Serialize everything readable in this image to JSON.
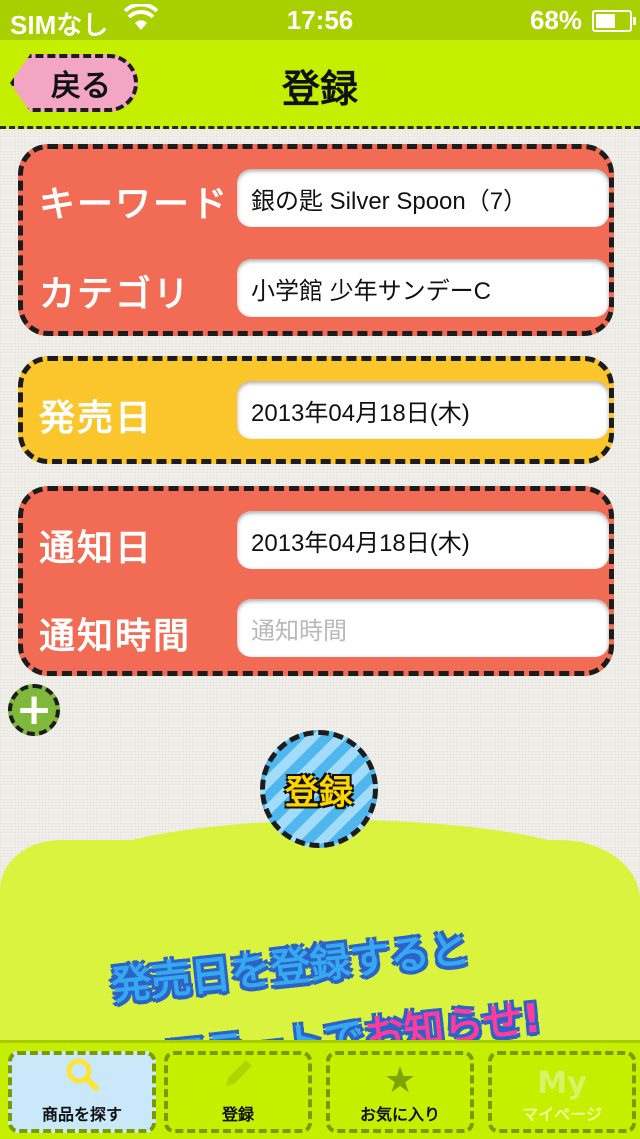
{
  "status_bar": {
    "carrier": "SIMなし",
    "time": "17:56",
    "battery_percent": "68%",
    "battery_level": 0.68
  },
  "nav": {
    "back_label": "戻る",
    "title": "登録"
  },
  "form": {
    "keyword_label": "キーワード",
    "keyword_value": "銀の匙 Silver Spoon（7）",
    "category_label": "カテゴリ",
    "category_value": "小学館 少年サンデーC",
    "release_label": "発売日",
    "release_value": "2013年04月18日(木)",
    "notify_date_label": "通知日",
    "notify_date_value": "2013年04月18日(木)",
    "notify_time_label": "通知時間",
    "notify_time_placeholder": "通知時間"
  },
  "add_button": "+",
  "submit_label": "登録",
  "promo": {
    "line1": "発売日を登録すると",
    "line2_a": "アラートで",
    "line2_b": "お知らせ!"
  },
  "tabs": [
    {
      "label": "商品を探す",
      "icon": "search-icon"
    },
    {
      "label": "登録",
      "icon": "pencil-icon"
    },
    {
      "label": "お気に入り",
      "icon": "star-icon"
    },
    {
      "label": "マイページ",
      "icon": "my-icon"
    }
  ],
  "colors": {
    "accent_green": "#c6ef00",
    "card_red": "#f26b55",
    "card_yellow": "#fbc62c",
    "back_pink": "#f3a6c4"
  }
}
